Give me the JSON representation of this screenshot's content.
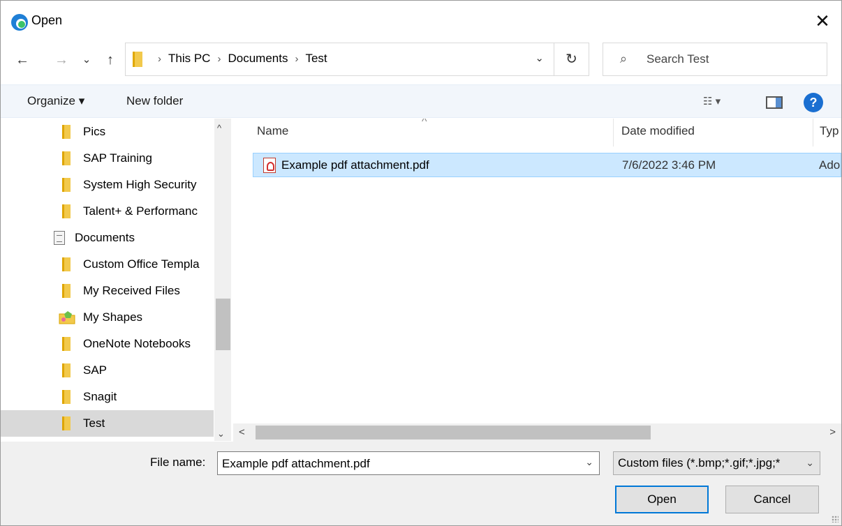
{
  "window": {
    "title": "Open",
    "close_glyph": "✕",
    "app_icon": "edge-icon"
  },
  "nav": {
    "back_glyph": "←",
    "forward_glyph": "→",
    "recent_glyph": "⌄",
    "up_glyph": "↑"
  },
  "address": {
    "crumbs": [
      "This PC",
      "Documents",
      "Test"
    ],
    "separator": "›",
    "dropdown_glyph": "⌄",
    "refresh_glyph": "↻"
  },
  "search": {
    "placeholder": "Search Test",
    "icon": "search-icon"
  },
  "toolbar": {
    "organize": "Organize ▾",
    "new_folder": "New folder",
    "view_glyph": "☷ ▾",
    "help_glyph": "?"
  },
  "sidebar": {
    "items": [
      {
        "label": "Pics",
        "icon": "folder-icon"
      },
      {
        "label": "SAP Training",
        "icon": "folder-icon"
      },
      {
        "label": "System High Security",
        "icon": "folder-icon"
      },
      {
        "label": "Talent+ & Performanc",
        "icon": "folder-icon"
      },
      {
        "label": "Documents",
        "icon": "documents-icon"
      },
      {
        "label": "Custom Office Templa",
        "icon": "folder-icon"
      },
      {
        "label": "My Received Files",
        "icon": "folder-icon"
      },
      {
        "label": "My Shapes",
        "icon": "shapes-icon"
      },
      {
        "label": "OneNote Notebooks",
        "icon": "folder-icon"
      },
      {
        "label": "SAP",
        "icon": "folder-icon"
      },
      {
        "label": "Snagit",
        "icon": "folder-icon"
      },
      {
        "label": "Test",
        "icon": "folder-icon"
      }
    ],
    "selected": "Test",
    "scroll_up": "^",
    "scroll_down": "⌄"
  },
  "files": {
    "sort_glyph": "^",
    "columns": {
      "name": "Name",
      "date": "Date modified",
      "type": "Typ"
    },
    "rows": [
      {
        "name": "Example pdf attachment.pdf",
        "date": "7/6/2022 3:46 PM",
        "type": "Ado"
      }
    ],
    "hscroll_left": "<",
    "hscroll_right": ">"
  },
  "footer": {
    "file_name_label": "File name:",
    "file_name_value": "Example pdf attachment.pdf",
    "filter_value": "Custom files (*.bmp;*.gif;*.jpg;*",
    "dropdown_glyph": "⌄",
    "open_label": "Open",
    "cancel_label": "Cancel"
  },
  "colors": {
    "accent": "#0078d7",
    "selection": "#cce8ff",
    "folder": "#f2c94c",
    "help": "#1a6fd1"
  }
}
